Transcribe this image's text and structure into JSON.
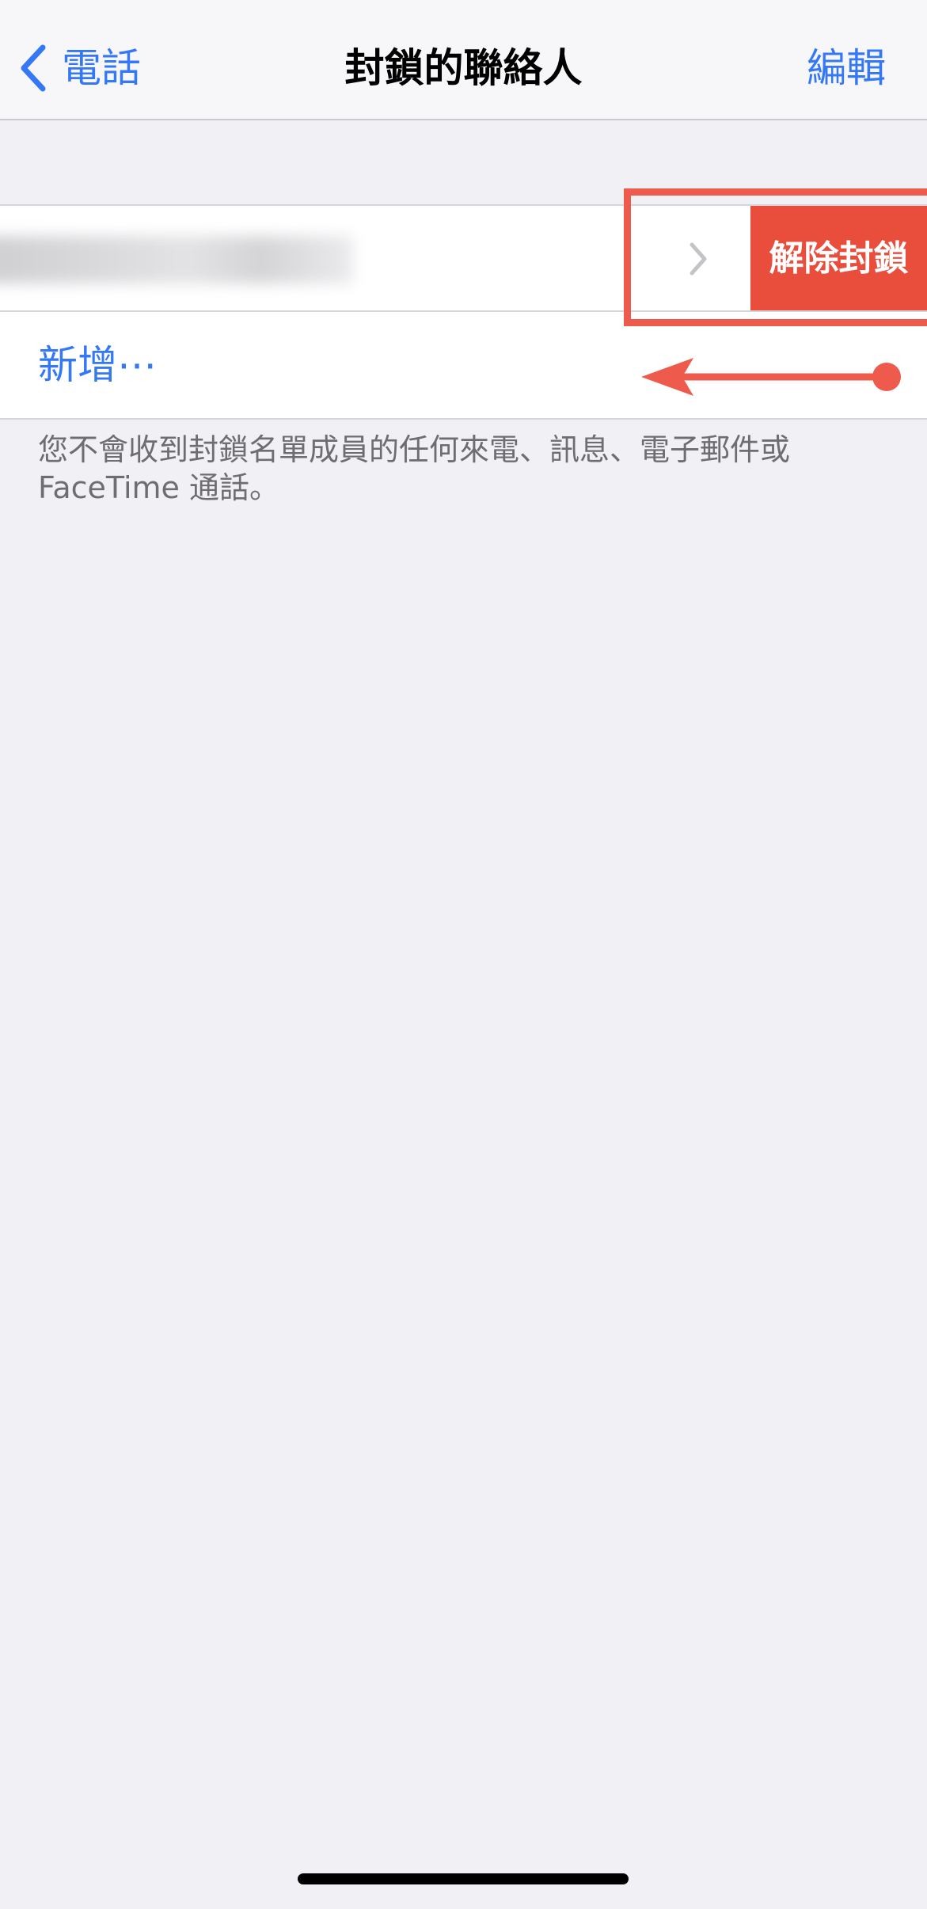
{
  "nav": {
    "back_label": "電話",
    "title": "封鎖的聯絡人",
    "edit_label": "編輯"
  },
  "blocked_list": {
    "unblock_label": "解除封鎖",
    "add_label": "新增⋯"
  },
  "footer": {
    "note": "您不會收到封鎖名單成員的任何來電、訊息、電子郵件或 FaceTime 通話。"
  },
  "colors": {
    "accent": "#3478f6",
    "destructive": "#e94d3c",
    "annotation": "#ee5b4c",
    "background": "#f0f0f5"
  },
  "icons": {
    "back": "chevron-left-icon",
    "disclosure": "chevron-right-icon",
    "annotation": "swipe-left-arrow-icon"
  }
}
